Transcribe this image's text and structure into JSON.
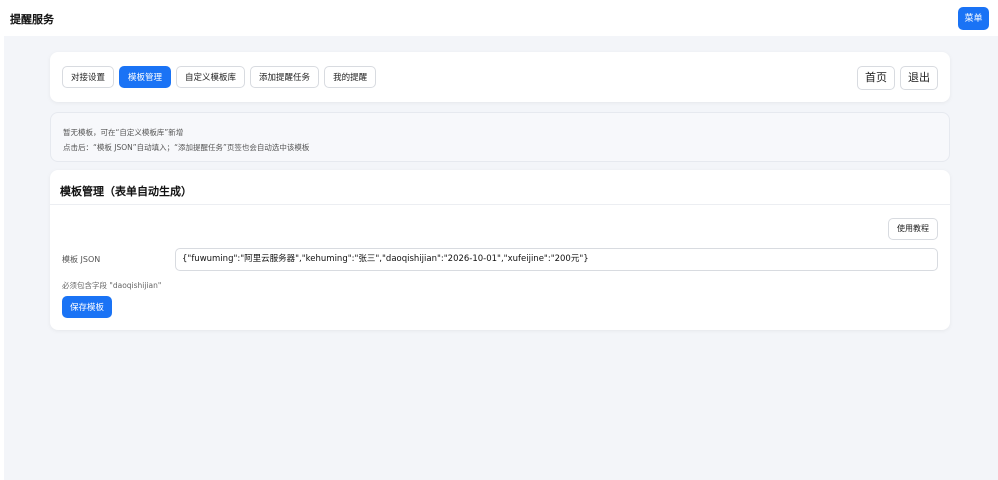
{
  "app": {
    "title": "提醒服务",
    "menu_label": "菜单"
  },
  "nav": {
    "tabs": [
      {
        "label": "对接设置",
        "active": false
      },
      {
        "label": "模板管理",
        "active": true
      },
      {
        "label": "自定义模板库",
        "active": false
      },
      {
        "label": "添加提醒任务",
        "active": false
      },
      {
        "label": "我的提醒",
        "active": false
      }
    ],
    "home_label": "首页",
    "logout_label": "退出"
  },
  "info": {
    "line1": "暂无模板，可在“自定义模板库”新增",
    "line2": "点击后：“模板 JSON”自动填入；“添加提醒任务”页签也会自动选中该模板"
  },
  "template": {
    "section_title": "模板管理（表单自动生成）",
    "tutorial_label": "使用教程",
    "json_label": "模板 JSON",
    "json_value": "{\"fuwuming\":\"阿里云服务器\",\"kehuming\":\"张三\",\"daoqishijian\":\"2026-10-01\",\"xufeijine\":\"200元\"}",
    "hint": "必须包含字段 \"daoqishijian\"",
    "save_label": "保存模板"
  },
  "colors": {
    "accent": "#1a73f5",
    "background": "#f3f5f9"
  }
}
